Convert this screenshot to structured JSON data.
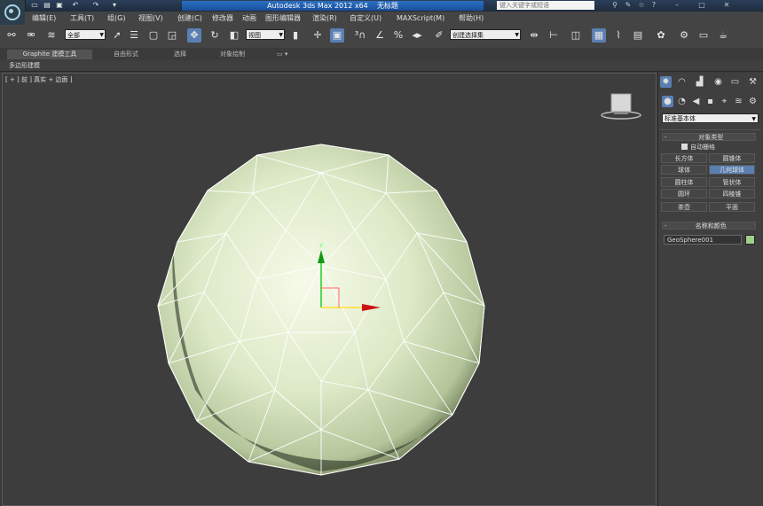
{
  "title_bar": {
    "app_title": "Autodesk 3ds Max  2012 x64",
    "doc_title": "无标题",
    "search_placeholder": "键入关键字或短语",
    "quick_access_icons": [
      "new-file-icon",
      "open-icon",
      "save-icon",
      "undo-icon",
      "redo-icon",
      "dropdown-icon"
    ],
    "window_icons": [
      "binoculars-icon",
      "tools-icon",
      "star-icon",
      "help-icon",
      "minimize-icon",
      "maximize-icon",
      "close-icon"
    ]
  },
  "menu": {
    "items": [
      "编辑(E)",
      "工具(T)",
      "组(G)",
      "视图(V)",
      "创建(C)",
      "修改器",
      "动画",
      "图形编辑器",
      "渲染(R)",
      "自定义(U)",
      "MAXScript(M)",
      "帮助(H)"
    ]
  },
  "toolbar": {
    "selection_filter": "全部",
    "reference_coord": "视图",
    "named_selection": "创建选择集",
    "icons": [
      "link-icon",
      "unlink-icon",
      "bind-spacewarp-icon",
      "select-icon",
      "select-by-name-icon",
      "rect-selection-icon",
      "window-crossing-icon",
      "select-move-icon",
      "select-rotate-icon",
      "select-scale-icon",
      "pivot-center-icon",
      "manipulate-icon",
      "keyboard-shortcut-icon",
      "snap-3d-icon",
      "angle-snap-icon",
      "percent-snap-icon",
      "spinner-snap-icon",
      "edit-named-selection-icon",
      "mirror-icon",
      "align-icon",
      "layers-icon",
      "graphite-toggle-icon",
      "curve-editor-icon",
      "schematic-view-icon",
      "material-editor-icon",
      "render-setup-icon",
      "rendered-frame-icon",
      "render-icon"
    ]
  },
  "ribbon": {
    "tabs": [
      "Graphite 建模工具",
      "自由形式",
      "选择",
      "对象绘制"
    ],
    "sub_label": "多边形建模"
  },
  "viewport": {
    "label": "[ + ] 前 ] 真实 + 边面 ]",
    "gizmo_y_label": "y",
    "object_color": "#cfe0b8"
  },
  "command_panel": {
    "tab_icons": [
      "create-icon",
      "modify-icon",
      "hierarchy-icon",
      "motion-icon",
      "display-icon",
      "utilities-icon"
    ],
    "sub_icons": [
      "geometry-icon",
      "shapes-icon",
      "lights-icon",
      "cameras-icon",
      "helpers-icon",
      "spacewarps-icon",
      "systems-icon"
    ],
    "category": "标准基本体",
    "object_type_title": "对象类型",
    "autogrid_label": "自动栅格",
    "buttons": [
      "长方体",
      "圆锥体",
      "球体",
      "几何球体",
      "圆柱体",
      "管状体",
      "圆环",
      "四棱锥",
      "茶壶",
      "平面"
    ],
    "name_color_title": "名称和颜色",
    "object_name": "GeoSphere001",
    "object_color": "#a0d08c"
  }
}
